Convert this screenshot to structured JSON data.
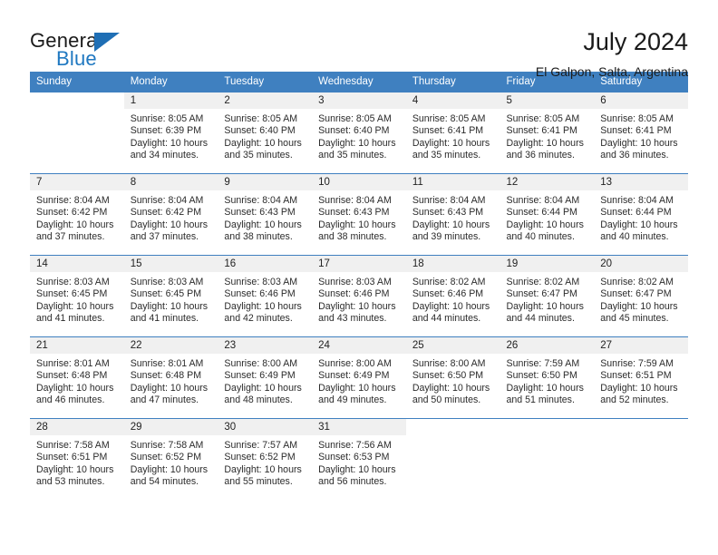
{
  "brand": {
    "name_part1": "General",
    "name_part2": "Blue",
    "triangle_color": "#1f6fb5",
    "blue_color": "#1f78c1"
  },
  "header": {
    "title": "July 2024",
    "location": "El Galpon, Salta, Argentina"
  },
  "calendar": {
    "header_bg": "#3f80c0",
    "daynum_bg": "#f0f0f0",
    "weekday_headers": [
      "Sunday",
      "Monday",
      "Tuesday",
      "Wednesday",
      "Thursday",
      "Friday",
      "Saturday"
    ],
    "weeks": [
      [
        {
          "day": "",
          "sunrise": "",
          "sunset": "",
          "daylight_line1": "",
          "daylight_line2": ""
        },
        {
          "day": "1",
          "sunrise": "Sunrise: 8:05 AM",
          "sunset": "Sunset: 6:39 PM",
          "daylight_line1": "Daylight: 10 hours",
          "daylight_line2": "and 34 minutes."
        },
        {
          "day": "2",
          "sunrise": "Sunrise: 8:05 AM",
          "sunset": "Sunset: 6:40 PM",
          "daylight_line1": "Daylight: 10 hours",
          "daylight_line2": "and 35 minutes."
        },
        {
          "day": "3",
          "sunrise": "Sunrise: 8:05 AM",
          "sunset": "Sunset: 6:40 PM",
          "daylight_line1": "Daylight: 10 hours",
          "daylight_line2": "and 35 minutes."
        },
        {
          "day": "4",
          "sunrise": "Sunrise: 8:05 AM",
          "sunset": "Sunset: 6:41 PM",
          "daylight_line1": "Daylight: 10 hours",
          "daylight_line2": "and 35 minutes."
        },
        {
          "day": "5",
          "sunrise": "Sunrise: 8:05 AM",
          "sunset": "Sunset: 6:41 PM",
          "daylight_line1": "Daylight: 10 hours",
          "daylight_line2": "and 36 minutes."
        },
        {
          "day": "6",
          "sunrise": "Sunrise: 8:05 AM",
          "sunset": "Sunset: 6:41 PM",
          "daylight_line1": "Daylight: 10 hours",
          "daylight_line2": "and 36 minutes."
        }
      ],
      [
        {
          "day": "7",
          "sunrise": "Sunrise: 8:04 AM",
          "sunset": "Sunset: 6:42 PM",
          "daylight_line1": "Daylight: 10 hours",
          "daylight_line2": "and 37 minutes."
        },
        {
          "day": "8",
          "sunrise": "Sunrise: 8:04 AM",
          "sunset": "Sunset: 6:42 PM",
          "daylight_line1": "Daylight: 10 hours",
          "daylight_line2": "and 37 minutes."
        },
        {
          "day": "9",
          "sunrise": "Sunrise: 8:04 AM",
          "sunset": "Sunset: 6:43 PM",
          "daylight_line1": "Daylight: 10 hours",
          "daylight_line2": "and 38 minutes."
        },
        {
          "day": "10",
          "sunrise": "Sunrise: 8:04 AM",
          "sunset": "Sunset: 6:43 PM",
          "daylight_line1": "Daylight: 10 hours",
          "daylight_line2": "and 38 minutes."
        },
        {
          "day": "11",
          "sunrise": "Sunrise: 8:04 AM",
          "sunset": "Sunset: 6:43 PM",
          "daylight_line1": "Daylight: 10 hours",
          "daylight_line2": "and 39 minutes."
        },
        {
          "day": "12",
          "sunrise": "Sunrise: 8:04 AM",
          "sunset": "Sunset: 6:44 PM",
          "daylight_line1": "Daylight: 10 hours",
          "daylight_line2": "and 40 minutes."
        },
        {
          "day": "13",
          "sunrise": "Sunrise: 8:04 AM",
          "sunset": "Sunset: 6:44 PM",
          "daylight_line1": "Daylight: 10 hours",
          "daylight_line2": "and 40 minutes."
        }
      ],
      [
        {
          "day": "14",
          "sunrise": "Sunrise: 8:03 AM",
          "sunset": "Sunset: 6:45 PM",
          "daylight_line1": "Daylight: 10 hours",
          "daylight_line2": "and 41 minutes."
        },
        {
          "day": "15",
          "sunrise": "Sunrise: 8:03 AM",
          "sunset": "Sunset: 6:45 PM",
          "daylight_line1": "Daylight: 10 hours",
          "daylight_line2": "and 41 minutes."
        },
        {
          "day": "16",
          "sunrise": "Sunrise: 8:03 AM",
          "sunset": "Sunset: 6:46 PM",
          "daylight_line1": "Daylight: 10 hours",
          "daylight_line2": "and 42 minutes."
        },
        {
          "day": "17",
          "sunrise": "Sunrise: 8:03 AM",
          "sunset": "Sunset: 6:46 PM",
          "daylight_line1": "Daylight: 10 hours",
          "daylight_line2": "and 43 minutes."
        },
        {
          "day": "18",
          "sunrise": "Sunrise: 8:02 AM",
          "sunset": "Sunset: 6:46 PM",
          "daylight_line1": "Daylight: 10 hours",
          "daylight_line2": "and 44 minutes."
        },
        {
          "day": "19",
          "sunrise": "Sunrise: 8:02 AM",
          "sunset": "Sunset: 6:47 PM",
          "daylight_line1": "Daylight: 10 hours",
          "daylight_line2": "and 44 minutes."
        },
        {
          "day": "20",
          "sunrise": "Sunrise: 8:02 AM",
          "sunset": "Sunset: 6:47 PM",
          "daylight_line1": "Daylight: 10 hours",
          "daylight_line2": "and 45 minutes."
        }
      ],
      [
        {
          "day": "21",
          "sunrise": "Sunrise: 8:01 AM",
          "sunset": "Sunset: 6:48 PM",
          "daylight_line1": "Daylight: 10 hours",
          "daylight_line2": "and 46 minutes."
        },
        {
          "day": "22",
          "sunrise": "Sunrise: 8:01 AM",
          "sunset": "Sunset: 6:48 PM",
          "daylight_line1": "Daylight: 10 hours",
          "daylight_line2": "and 47 minutes."
        },
        {
          "day": "23",
          "sunrise": "Sunrise: 8:00 AM",
          "sunset": "Sunset: 6:49 PM",
          "daylight_line1": "Daylight: 10 hours",
          "daylight_line2": "and 48 minutes."
        },
        {
          "day": "24",
          "sunrise": "Sunrise: 8:00 AM",
          "sunset": "Sunset: 6:49 PM",
          "daylight_line1": "Daylight: 10 hours",
          "daylight_line2": "and 49 minutes."
        },
        {
          "day": "25",
          "sunrise": "Sunrise: 8:00 AM",
          "sunset": "Sunset: 6:50 PM",
          "daylight_line1": "Daylight: 10 hours",
          "daylight_line2": "and 50 minutes."
        },
        {
          "day": "26",
          "sunrise": "Sunrise: 7:59 AM",
          "sunset": "Sunset: 6:50 PM",
          "daylight_line1": "Daylight: 10 hours",
          "daylight_line2": "and 51 minutes."
        },
        {
          "day": "27",
          "sunrise": "Sunrise: 7:59 AM",
          "sunset": "Sunset: 6:51 PM",
          "daylight_line1": "Daylight: 10 hours",
          "daylight_line2": "and 52 minutes."
        }
      ],
      [
        {
          "day": "28",
          "sunrise": "Sunrise: 7:58 AM",
          "sunset": "Sunset: 6:51 PM",
          "daylight_line1": "Daylight: 10 hours",
          "daylight_line2": "and 53 minutes."
        },
        {
          "day": "29",
          "sunrise": "Sunrise: 7:58 AM",
          "sunset": "Sunset: 6:52 PM",
          "daylight_line1": "Daylight: 10 hours",
          "daylight_line2": "and 54 minutes."
        },
        {
          "day": "30",
          "sunrise": "Sunrise: 7:57 AM",
          "sunset": "Sunset: 6:52 PM",
          "daylight_line1": "Daylight: 10 hours",
          "daylight_line2": "and 55 minutes."
        },
        {
          "day": "31",
          "sunrise": "Sunrise: 7:56 AM",
          "sunset": "Sunset: 6:53 PM",
          "daylight_line1": "Daylight: 10 hours",
          "daylight_line2": "and 56 minutes."
        },
        {
          "day": "",
          "sunrise": "",
          "sunset": "",
          "daylight_line1": "",
          "daylight_line2": ""
        },
        {
          "day": "",
          "sunrise": "",
          "sunset": "",
          "daylight_line1": "",
          "daylight_line2": ""
        },
        {
          "day": "",
          "sunrise": "",
          "sunset": "",
          "daylight_line1": "",
          "daylight_line2": ""
        }
      ]
    ]
  }
}
